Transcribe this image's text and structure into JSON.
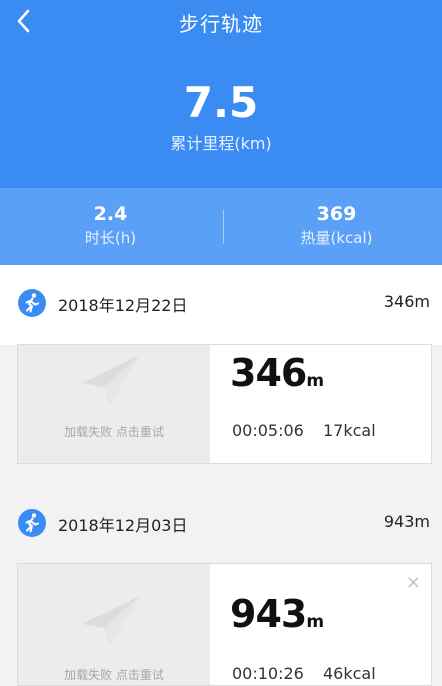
{
  "header": {
    "title": "步行轨迹",
    "total_distance": "7.5",
    "total_label": "累计里程(km)"
  },
  "stats": {
    "duration_value": "2.4",
    "duration_label": "时长(h)",
    "calories_value": "369",
    "calories_label": "热量(kcal)"
  },
  "days": [
    {
      "date": "2018年12月22日",
      "distance": "346m",
      "record": {
        "map_status": "加载失败 点击重试",
        "distance_number": "346",
        "distance_unit": "m",
        "duration": "00:05:06",
        "calories": "17kcal"
      }
    },
    {
      "date": "2018年12月03日",
      "distance": "943m",
      "record": {
        "map_status": "加载失败 点击重试",
        "distance_number": "943",
        "distance_unit": "m",
        "duration": "00:10:26",
        "calories": "46kcal",
        "close_symbol": "×"
      }
    }
  ],
  "icons": {
    "back": "chevron-left-icon",
    "walk": "walking-person-icon",
    "map_placeholder": "paper-plane-icon"
  },
  "colors": {
    "header_bg": "#3a8cf3",
    "stats_bg": "#5aa0f7"
  }
}
